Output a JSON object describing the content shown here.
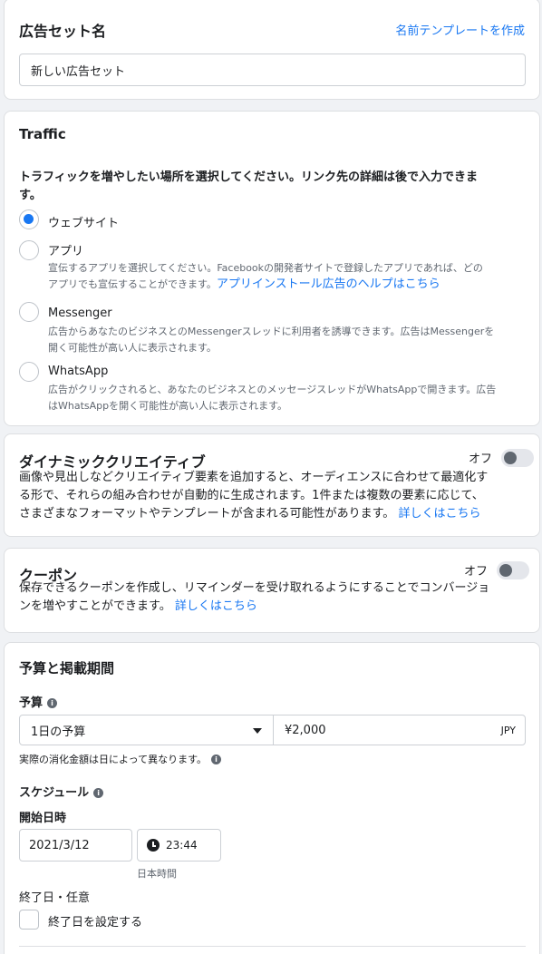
{
  "ad_set_name": {
    "title": "広告セット名",
    "template_link": "名前テンプレートを作成",
    "name_value": "新しい広告セット"
  },
  "traffic": {
    "title": "Traffic",
    "instruction_line1": "トラフィックを増やしたい場所を選択してください。リンク先の詳細は後で入力できま",
    "instruction_line2": "す。",
    "options": [
      {
        "label": "ウェブサイト",
        "selected": true
      },
      {
        "label": "アプリ",
        "desc_line1": "宣伝するアプリを選択してください。Facebookの開発者サイトで登録したアプリであれば、どの",
        "desc_line2": "アプリでも宣伝することができます。",
        "link": "アプリインストール広告のヘルプはこちら"
      },
      {
        "label": "Messenger",
        "desc_line1": "広告からあなたのビジネスとのMessengerスレッドに利用者を誘導できます。広告はMessengerを",
        "desc_line2": "開く可能性が高い人に表示されます。"
      },
      {
        "label": "WhatsApp",
        "desc_line1": "広告がクリックされると、あなたのビジネスとのメッセージスレッドがWhatsAppで開きます。広告",
        "desc_line2": "はWhatsAppを開く可能性が高い人に表示されます。"
      }
    ]
  },
  "dynamic_creative": {
    "title": "ダイナミッククリエイティブ",
    "toggle_label": "オフ",
    "line1": "画像や見出しなどクリエイティブ要素を追加すると、オーディエンスに合わせて最適化す",
    "line2": "る形で、それらの組み合わせが自動的に生成されます。1件または複数の要素に応じて、",
    "line3": "さまざまなフォーマットやテンプレートが含まれる可能性があります。",
    "link": "詳しくはこちら"
  },
  "coupon": {
    "title": "クーポン",
    "toggle_label": "オフ",
    "line1": "保存できるクーポンを作成し、リマインダーを受け取れるようにすることでコンバージョ",
    "line2": "ンを増やすことができます。",
    "link": "詳しくはこちら"
  },
  "budget": {
    "title": "予算と掲載期間",
    "budget_label": "予算",
    "budget_type": "1日の予算",
    "amount": "¥2,000",
    "currency": "JPY",
    "note": "実際の消化金額は日によって異なります。",
    "schedule_label": "スケジュール",
    "start_label": "開始日時",
    "start_date": "2021/3/12",
    "start_time": "23:44",
    "timezone": "日本時間",
    "end_label": "終了日・任意",
    "end_checkbox_label": "終了日を設定する"
  },
  "colors": {
    "accent": "#1877f2",
    "border": "#dddfe2",
    "bg": "#f0f2f5"
  }
}
